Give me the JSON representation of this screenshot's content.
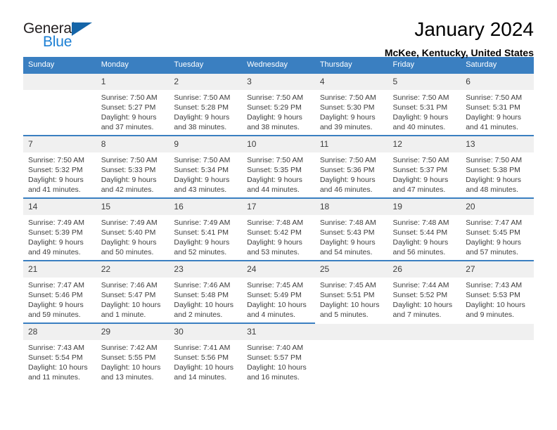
{
  "logo": {
    "word1": "General",
    "word2": "Blue",
    "triangle_color": "#1565a8",
    "word2_color": "#1b7fd4"
  },
  "header": {
    "title": "January 2024",
    "subtitle": "McKee, Kentucky, United States"
  },
  "calendar": {
    "header_bg": "#3a7fc1",
    "daynum_bg": "#f0f0f0",
    "weekdays": [
      "Sunday",
      "Monday",
      "Tuesday",
      "Wednesday",
      "Thursday",
      "Friday",
      "Saturday"
    ],
    "weeks": [
      [
        {
          "day": "",
          "empty": true,
          "sunrise": "",
          "sunset": "",
          "daylight1": "",
          "daylight2": ""
        },
        {
          "day": "1",
          "sunrise": "Sunrise: 7:50 AM",
          "sunset": "Sunset: 5:27 PM",
          "daylight1": "Daylight: 9 hours",
          "daylight2": "and 37 minutes."
        },
        {
          "day": "2",
          "sunrise": "Sunrise: 7:50 AM",
          "sunset": "Sunset: 5:28 PM",
          "daylight1": "Daylight: 9 hours",
          "daylight2": "and 38 minutes."
        },
        {
          "day": "3",
          "sunrise": "Sunrise: 7:50 AM",
          "sunset": "Sunset: 5:29 PM",
          "daylight1": "Daylight: 9 hours",
          "daylight2": "and 38 minutes."
        },
        {
          "day": "4",
          "sunrise": "Sunrise: 7:50 AM",
          "sunset": "Sunset: 5:30 PM",
          "daylight1": "Daylight: 9 hours",
          "daylight2": "and 39 minutes."
        },
        {
          "day": "5",
          "sunrise": "Sunrise: 7:50 AM",
          "sunset": "Sunset: 5:31 PM",
          "daylight1": "Daylight: 9 hours",
          "daylight2": "and 40 minutes."
        },
        {
          "day": "6",
          "sunrise": "Sunrise: 7:50 AM",
          "sunset": "Sunset: 5:31 PM",
          "daylight1": "Daylight: 9 hours",
          "daylight2": "and 41 minutes."
        }
      ],
      [
        {
          "day": "7",
          "sunrise": "Sunrise: 7:50 AM",
          "sunset": "Sunset: 5:32 PM",
          "daylight1": "Daylight: 9 hours",
          "daylight2": "and 41 minutes."
        },
        {
          "day": "8",
          "sunrise": "Sunrise: 7:50 AM",
          "sunset": "Sunset: 5:33 PM",
          "daylight1": "Daylight: 9 hours",
          "daylight2": "and 42 minutes."
        },
        {
          "day": "9",
          "sunrise": "Sunrise: 7:50 AM",
          "sunset": "Sunset: 5:34 PM",
          "daylight1": "Daylight: 9 hours",
          "daylight2": "and 43 minutes."
        },
        {
          "day": "10",
          "sunrise": "Sunrise: 7:50 AM",
          "sunset": "Sunset: 5:35 PM",
          "daylight1": "Daylight: 9 hours",
          "daylight2": "and 44 minutes."
        },
        {
          "day": "11",
          "sunrise": "Sunrise: 7:50 AM",
          "sunset": "Sunset: 5:36 PM",
          "daylight1": "Daylight: 9 hours",
          "daylight2": "and 46 minutes."
        },
        {
          "day": "12",
          "sunrise": "Sunrise: 7:50 AM",
          "sunset": "Sunset: 5:37 PM",
          "daylight1": "Daylight: 9 hours",
          "daylight2": "and 47 minutes."
        },
        {
          "day": "13",
          "sunrise": "Sunrise: 7:50 AM",
          "sunset": "Sunset: 5:38 PM",
          "daylight1": "Daylight: 9 hours",
          "daylight2": "and 48 minutes."
        }
      ],
      [
        {
          "day": "14",
          "sunrise": "Sunrise: 7:49 AM",
          "sunset": "Sunset: 5:39 PM",
          "daylight1": "Daylight: 9 hours",
          "daylight2": "and 49 minutes."
        },
        {
          "day": "15",
          "sunrise": "Sunrise: 7:49 AM",
          "sunset": "Sunset: 5:40 PM",
          "daylight1": "Daylight: 9 hours",
          "daylight2": "and 50 minutes."
        },
        {
          "day": "16",
          "sunrise": "Sunrise: 7:49 AM",
          "sunset": "Sunset: 5:41 PM",
          "daylight1": "Daylight: 9 hours",
          "daylight2": "and 52 minutes."
        },
        {
          "day": "17",
          "sunrise": "Sunrise: 7:48 AM",
          "sunset": "Sunset: 5:42 PM",
          "daylight1": "Daylight: 9 hours",
          "daylight2": "and 53 minutes."
        },
        {
          "day": "18",
          "sunrise": "Sunrise: 7:48 AM",
          "sunset": "Sunset: 5:43 PM",
          "daylight1": "Daylight: 9 hours",
          "daylight2": "and 54 minutes."
        },
        {
          "day": "19",
          "sunrise": "Sunrise: 7:48 AM",
          "sunset": "Sunset: 5:44 PM",
          "daylight1": "Daylight: 9 hours",
          "daylight2": "and 56 minutes."
        },
        {
          "day": "20",
          "sunrise": "Sunrise: 7:47 AM",
          "sunset": "Sunset: 5:45 PM",
          "daylight1": "Daylight: 9 hours",
          "daylight2": "and 57 minutes."
        }
      ],
      [
        {
          "day": "21",
          "sunrise": "Sunrise: 7:47 AM",
          "sunset": "Sunset: 5:46 PM",
          "daylight1": "Daylight: 9 hours",
          "daylight2": "and 59 minutes."
        },
        {
          "day": "22",
          "sunrise": "Sunrise: 7:46 AM",
          "sunset": "Sunset: 5:47 PM",
          "daylight1": "Daylight: 10 hours",
          "daylight2": "and 1 minute."
        },
        {
          "day": "23",
          "sunrise": "Sunrise: 7:46 AM",
          "sunset": "Sunset: 5:48 PM",
          "daylight1": "Daylight: 10 hours",
          "daylight2": "and 2 minutes."
        },
        {
          "day": "24",
          "sunrise": "Sunrise: 7:45 AM",
          "sunset": "Sunset: 5:49 PM",
          "daylight1": "Daylight: 10 hours",
          "daylight2": "and 4 minutes."
        },
        {
          "day": "25",
          "sunrise": "Sunrise: 7:45 AM",
          "sunset": "Sunset: 5:51 PM",
          "daylight1": "Daylight: 10 hours",
          "daylight2": "and 5 minutes."
        },
        {
          "day": "26",
          "sunrise": "Sunrise: 7:44 AM",
          "sunset": "Sunset: 5:52 PM",
          "daylight1": "Daylight: 10 hours",
          "daylight2": "and 7 minutes."
        },
        {
          "day": "27",
          "sunrise": "Sunrise: 7:43 AM",
          "sunset": "Sunset: 5:53 PM",
          "daylight1": "Daylight: 10 hours",
          "daylight2": "and 9 minutes."
        }
      ],
      [
        {
          "day": "28",
          "sunrise": "Sunrise: 7:43 AM",
          "sunset": "Sunset: 5:54 PM",
          "daylight1": "Daylight: 10 hours",
          "daylight2": "and 11 minutes."
        },
        {
          "day": "29",
          "sunrise": "Sunrise: 7:42 AM",
          "sunset": "Sunset: 5:55 PM",
          "daylight1": "Daylight: 10 hours",
          "daylight2": "and 13 minutes."
        },
        {
          "day": "30",
          "sunrise": "Sunrise: 7:41 AM",
          "sunset": "Sunset: 5:56 PM",
          "daylight1": "Daylight: 10 hours",
          "daylight2": "and 14 minutes."
        },
        {
          "day": "31",
          "sunrise": "Sunrise: 7:40 AM",
          "sunset": "Sunset: 5:57 PM",
          "daylight1": "Daylight: 10 hours",
          "daylight2": "and 16 minutes."
        },
        {
          "day": "",
          "empty": true,
          "sunrise": "",
          "sunset": "",
          "daylight1": "",
          "daylight2": ""
        },
        {
          "day": "",
          "empty": true,
          "sunrise": "",
          "sunset": "",
          "daylight1": "",
          "daylight2": ""
        },
        {
          "day": "",
          "empty": true,
          "sunrise": "",
          "sunset": "",
          "daylight1": "",
          "daylight2": ""
        }
      ]
    ]
  }
}
